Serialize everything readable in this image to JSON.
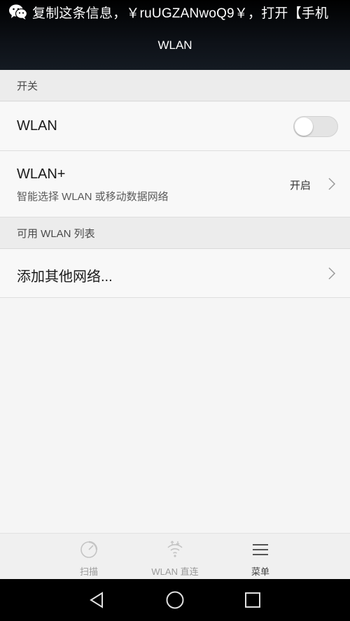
{
  "notification": {
    "icon": "wechat-icon",
    "text": "复制这条信息，￥ruUGZANwoQ9￥，打开【手机"
  },
  "title": "WLAN",
  "sections": {
    "switch_header": "开关",
    "list_header": "可用 WLAN 列表"
  },
  "wlan_toggle": {
    "label": "WLAN",
    "state": "off"
  },
  "wlan_plus": {
    "label": "WLAN+",
    "subtitle": "智能选择 WLAN 或移动数据网络",
    "value": "开启"
  },
  "add_network": {
    "label": "添加其他网络..."
  },
  "bottom_bar": {
    "scan": "扫描",
    "direct": "WLAN 直连",
    "menu": "菜单"
  },
  "colors": {
    "header_bg": "#000000",
    "page_bg": "#f5f5f5",
    "section_bg": "#ececec",
    "toggle_off": "#e4e4e4"
  }
}
